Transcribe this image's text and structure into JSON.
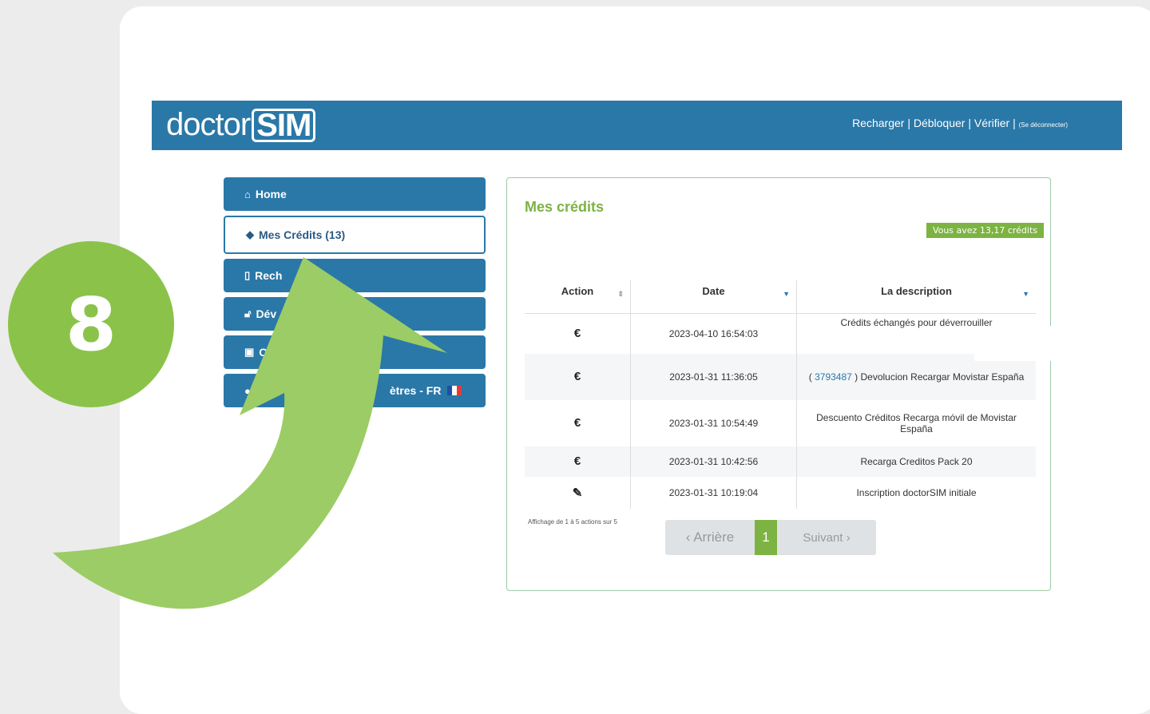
{
  "step_number": "8",
  "brand": {
    "prefix": "doctor",
    "highlight": "SIM"
  },
  "topnav": {
    "links": "Recharger | Débloquer | Vérifier |",
    "logout": "(Se déconnecter)"
  },
  "sidebar": {
    "items": [
      {
        "label": "Home",
        "icon": "home-icon"
      },
      {
        "label": "Mes Crédits (13)",
        "icon": "tags-icon"
      },
      {
        "label": "Rech",
        "icon": "mobile-icon"
      },
      {
        "label": "Dév",
        "icon": "unlock-icon"
      },
      {
        "label": "C",
        "icon": "money-icon"
      },
      {
        "label": "ètres - FR",
        "icon": "user-icon"
      }
    ]
  },
  "panel": {
    "title": "Mes crédits",
    "badge": "Vous avez 13,17 crédits",
    "columns": [
      "Action",
      "Date",
      "La description"
    ],
    "rows": [
      {
        "action": "€",
        "date": "2023-04-10 16:54:03",
        "desc": "Crédits échangés pour déverrouiller",
        "link": ""
      },
      {
        "action": "€",
        "date": "2023-01-31 11:36:05",
        "link": "3793487",
        "desc_pre": "( ",
        "desc": " ) Devolucion Recargar Movistar España"
      },
      {
        "action": "€",
        "date": "2023-01-31 10:54:49",
        "desc": "Descuento Créditos Recarga móvil de Movistar España",
        "link": ""
      },
      {
        "action": "€",
        "date": "2023-01-31 10:42:56",
        "desc": "Recarga Creditos Pack 20",
        "link": ""
      },
      {
        "action": "✎",
        "date": "2023-01-31 10:19:04",
        "desc": "Inscription doctorSIM initiale",
        "link": ""
      }
    ],
    "info": "Affichage de 1 à 5 actions sur 5",
    "pager": {
      "prev": "‹ Arrière",
      "current": "1",
      "next": "Suivant ›"
    }
  },
  "colors": {
    "brand_blue": "#2a78a8",
    "accent_green": "#8bc34a"
  }
}
